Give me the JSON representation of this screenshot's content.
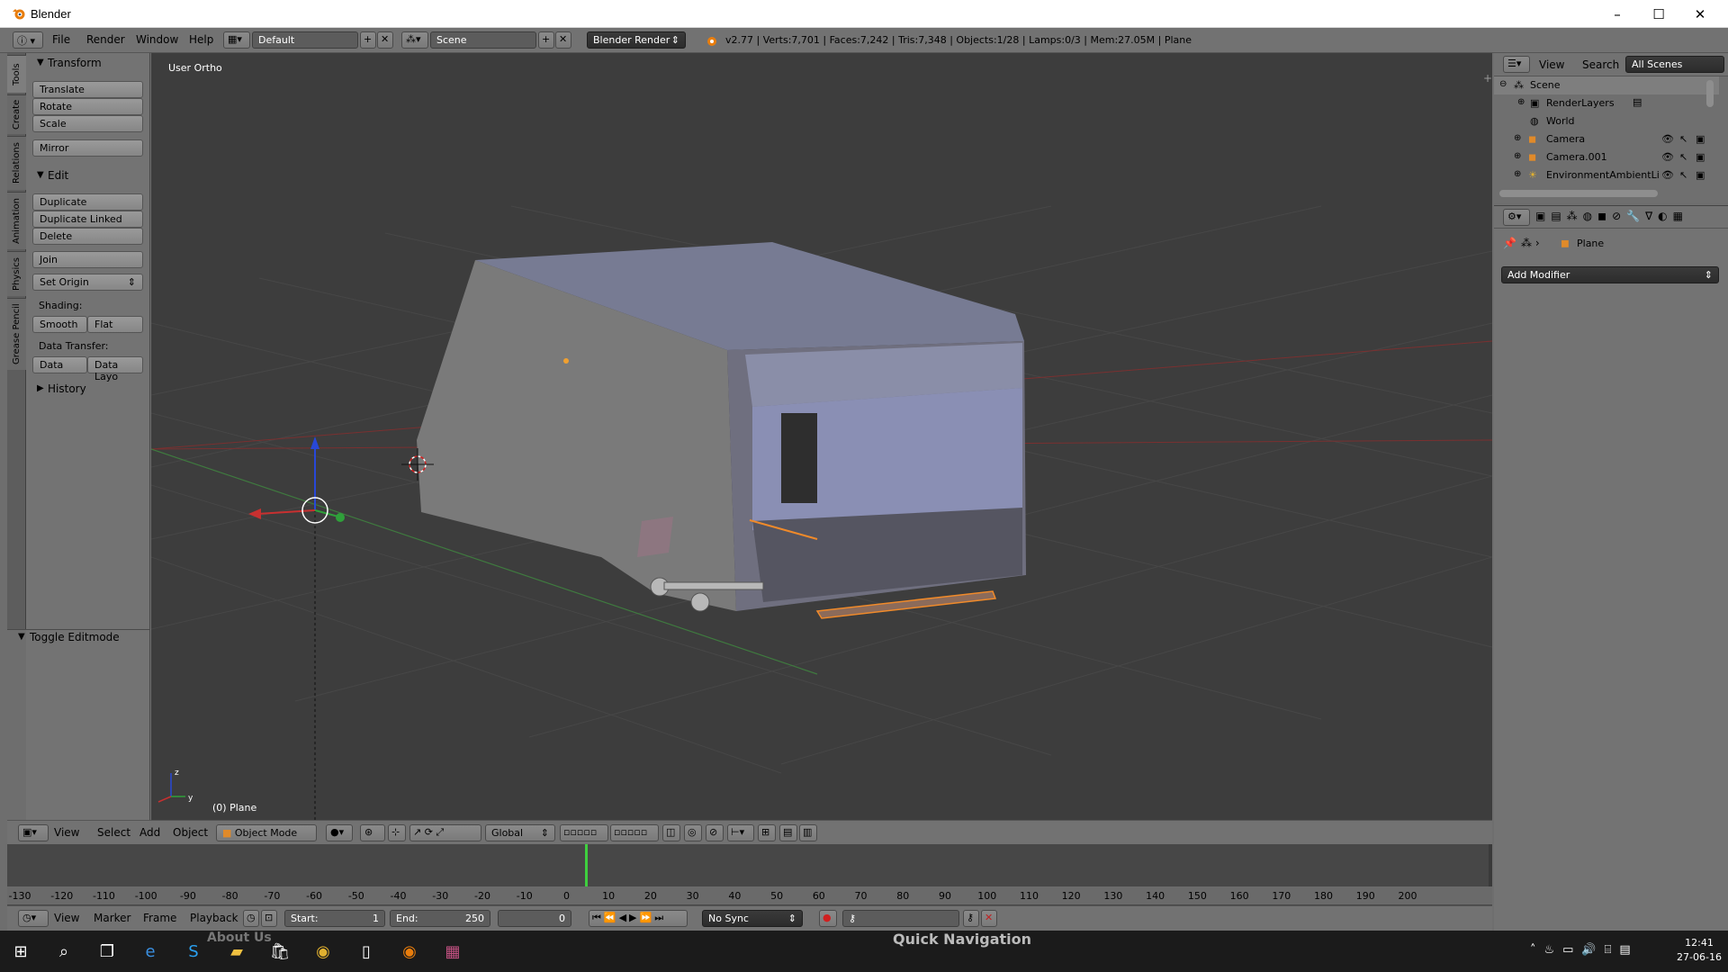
{
  "window": {
    "title": "Blender",
    "controls": [
      "–",
      "☐",
      "✕"
    ]
  },
  "info_header": {
    "menus": [
      "File",
      "Render",
      "Window",
      "Help"
    ],
    "layout": "Default",
    "scene": "Scene",
    "engine": "Blender Render",
    "stats": "v2.77 | Verts:7,701 | Faces:7,242 | Tris:7,348 | Objects:1/28 | Lamps:0/3 | Mem:27.05M | Plane"
  },
  "left_tabs": [
    "Tools",
    "Create",
    "Relations",
    "Animation",
    "Physics",
    "Grease Pencil"
  ],
  "toolshelf": {
    "transform": {
      "title": "Transform",
      "buttons": [
        "Translate",
        "Rotate",
        "Scale",
        "Mirror"
      ]
    },
    "edit": {
      "title": "Edit",
      "buttons": [
        "Duplicate",
        "Duplicate Linked",
        "Delete",
        "Join"
      ],
      "set_origin": "Set Origin",
      "shading_label": "Shading:",
      "smooth": "Smooth",
      "flat": "Flat",
      "data_transfer_label": "Data Transfer:",
      "data": "Data",
      "data_layo": "Data Layo"
    },
    "history": "History",
    "toggle_editmode": "Toggle Editmode"
  },
  "viewport": {
    "view_label": "User Ortho",
    "object_label": "(0) Plane"
  },
  "view3d_header": {
    "menus": [
      "View",
      "Select",
      "Add",
      "Object"
    ],
    "mode": "Object Mode",
    "orientation": "Global"
  },
  "timeline": {
    "ticks": [
      "-130",
      "-120",
      "-110",
      "-100",
      "-90",
      "-80",
      "-70",
      "-60",
      "-50",
      "-40",
      "-30",
      "-20",
      "-10",
      "0",
      "10",
      "20",
      "30",
      "40",
      "50",
      "60",
      "70",
      "80",
      "90",
      "100",
      "110",
      "120",
      "130",
      "140",
      "150",
      "160",
      "170",
      "180",
      "190",
      "200"
    ],
    "menus": [
      "View",
      "Marker",
      "Frame",
      "Playback"
    ],
    "start_label": "Start:",
    "start_value": "1",
    "end_label": "End:",
    "end_value": "250",
    "current_frame": "0",
    "sync": "No Sync"
  },
  "outliner": {
    "menus": [
      "View",
      "Search"
    ],
    "filter": "All Scenes",
    "rows": [
      "Scene",
      "RenderLayers",
      "World",
      "Camera",
      "Camera.001",
      "EnvironmentAmbientLi"
    ]
  },
  "properties": {
    "object_name": "Plane",
    "add_modifier": "Add Modifier"
  },
  "taskbar": {
    "time": "12:41",
    "date": "27-06-16",
    "overlay_text": "Quick Navigation",
    "overlay_text2": "About Us"
  },
  "colors": {
    "x_axis": "#c83030",
    "y_axis": "#2fa03a",
    "z_axis": "#2848d8",
    "frame_cursor": "#3fcf3f",
    "selection": "#f08a2a"
  }
}
